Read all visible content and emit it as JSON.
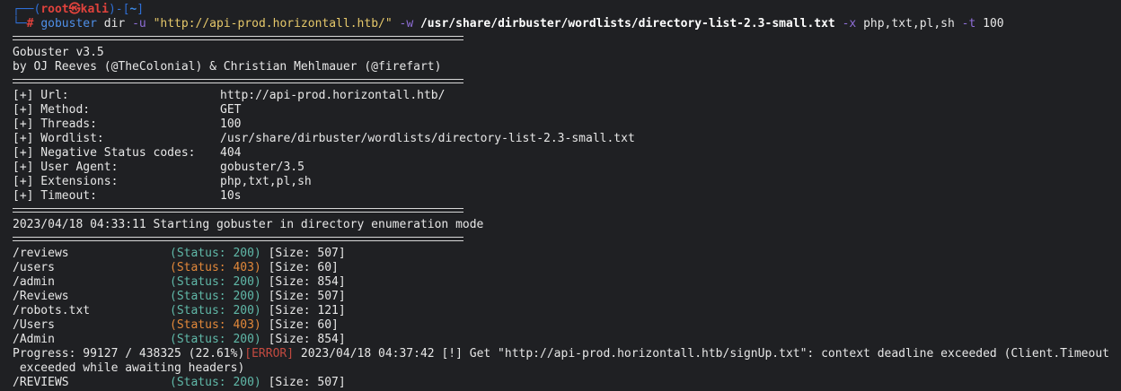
{
  "prompt": {
    "box_top": "┌──(",
    "user": "root㉿kali",
    "mid": ")-[",
    "dir": "~",
    "end": "]",
    "box_bottom": "└─",
    "hash": "#",
    "command": "gobuster",
    "sub": "dir",
    "flag_u": "-u",
    "url": "\"http://api-prod.horizontall.htb/\"",
    "flag_w": "-w",
    "wordlist": "/usr/share/dirbuster/wordlists/directory-list-2.3-small.txt",
    "flag_x": "-x",
    "extensions": "php,txt,pl,sh",
    "flag_t": "-t",
    "threads": "100"
  },
  "banner": {
    "line1": "Gobuster v3.5",
    "line2": "by OJ Reeves (@TheColonial) & Christian Mehlmauer (@firefart)"
  },
  "config": [
    {
      "key": "[+] Url:",
      "value": "http://api-prod.horizontall.htb/"
    },
    {
      "key": "[+] Method:",
      "value": "GET"
    },
    {
      "key": "[+] Threads:",
      "value": "100"
    },
    {
      "key": "[+] Wordlist:",
      "value": "/usr/share/dirbuster/wordlists/directory-list-2.3-small.txt"
    },
    {
      "key": "[+] Negative Status codes:",
      "value": "404"
    },
    {
      "key": "[+] User Agent:",
      "value": "gobuster/3.5"
    },
    {
      "key": "[+] Extensions:",
      "value": "php,txt,pl,sh"
    },
    {
      "key": "[+] Timeout:",
      "value": "10s"
    }
  ],
  "start_message": "2023/04/18 04:33:11 Starting gobuster in directory enumeration mode",
  "results": [
    {
      "path": "/reviews",
      "status": "(Status: 200)",
      "size": "[Size: 507]",
      "code": 200
    },
    {
      "path": "/users",
      "status": "(Status: 403)",
      "size": "[Size: 60]",
      "code": 403
    },
    {
      "path": "/admin",
      "status": "(Status: 200)",
      "size": "[Size: 854]",
      "code": 200
    },
    {
      "path": "/Reviews",
      "status": "(Status: 200)",
      "size": "[Size: 507]",
      "code": 200
    },
    {
      "path": "/robots.txt",
      "status": "(Status: 200)",
      "size": "[Size: 121]",
      "code": 200
    },
    {
      "path": "/Users",
      "status": "(Status: 403)",
      "size": "[Size: 60]",
      "code": 403
    },
    {
      "path": "/Admin",
      "status": "(Status: 200)",
      "size": "[Size: 854]",
      "code": 200
    }
  ],
  "progress": {
    "prefix": "Progress: 99127 / 438325 (22.61%)",
    "error_tag": "[ERROR]",
    "message": " 2023/04/18 04:37:42 [!] Get \"http://api-prod.horizontall.htb/signUp.txt\": context deadline exceeded (Client.Timeout",
    "continuation": " exceeded while awaiting headers)"
  },
  "last_result": {
    "path": "/REVIEWS",
    "status": "(Status: 200)",
    "size": "[Size: 507]",
    "code": 200
  },
  "colors": {
    "background": "#1f2023",
    "status_200": "#60b8a8",
    "status_403": "#e2883a",
    "error": "#c24a40",
    "prompt_user": "#e0423c",
    "prompt_box": "#2f6fd6"
  }
}
